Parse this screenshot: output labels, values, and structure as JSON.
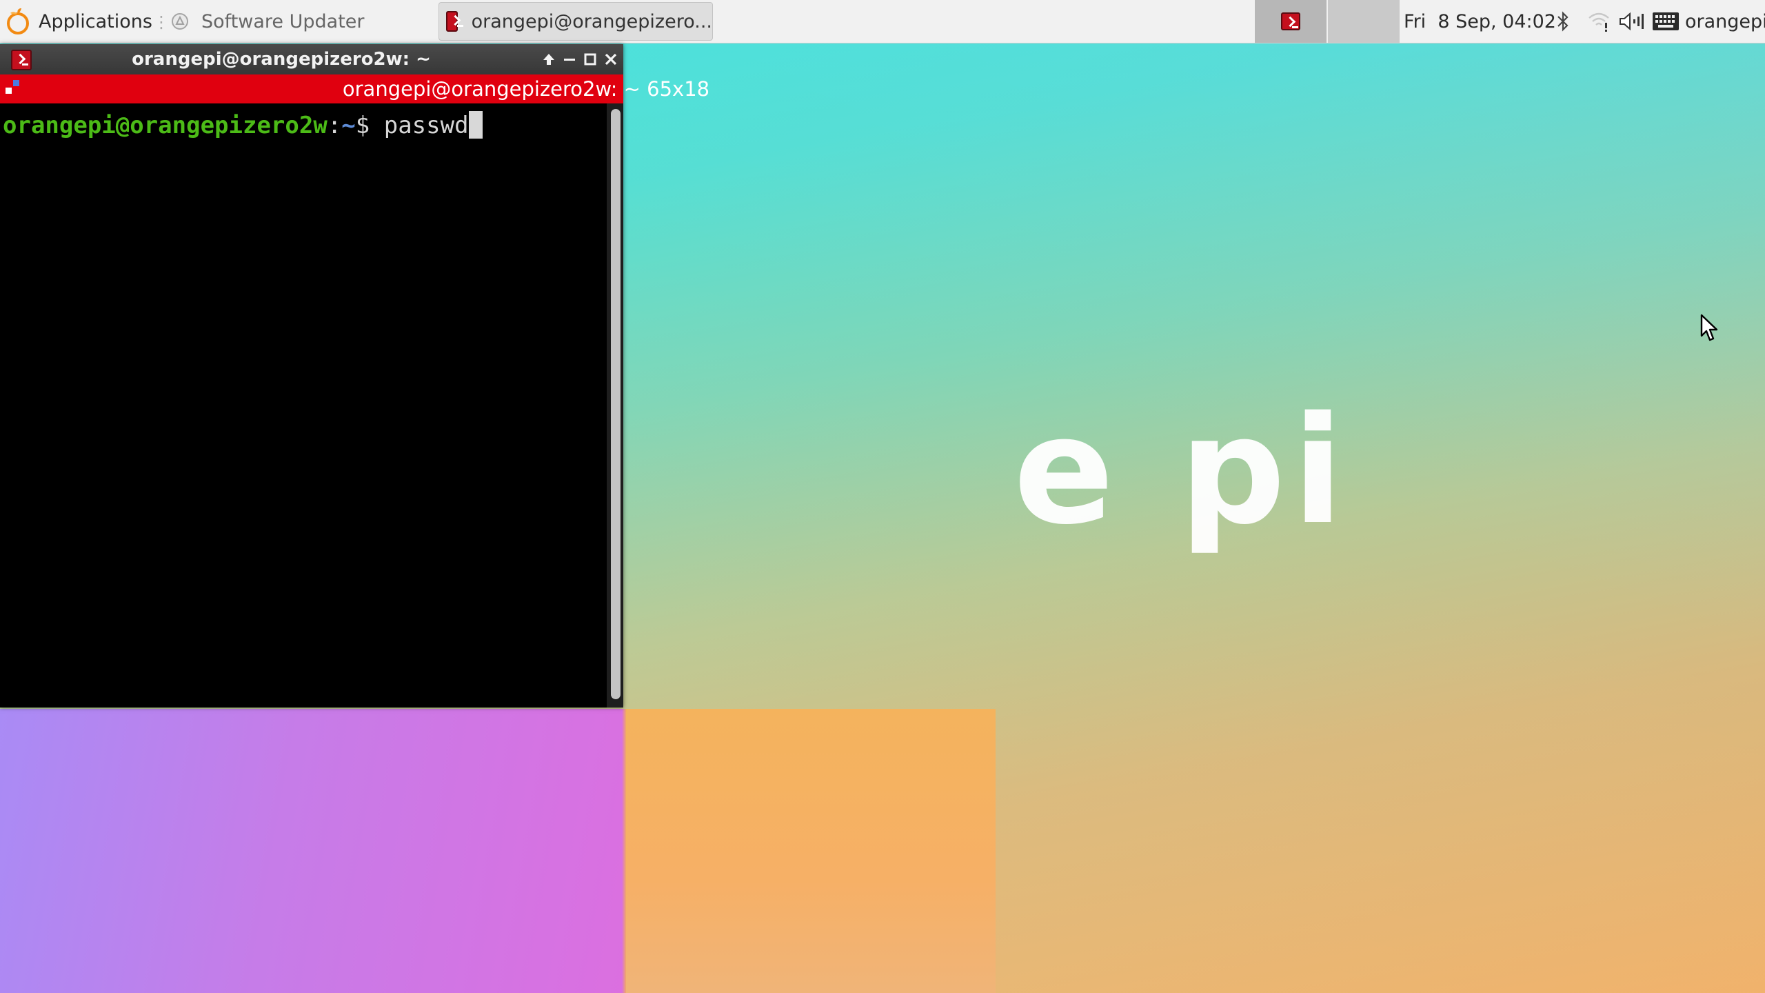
{
  "panel": {
    "applications_label": "Applications",
    "tasks": [
      {
        "label": "Software Updater",
        "icon": "software-updater-icon"
      },
      {
        "label": "orangepi@orangepizero...",
        "icon": "terminal-icon"
      }
    ],
    "clock": "Fri  8 Sep, 04:02",
    "user": "orangepi",
    "tray_icons": [
      "bluetooth-icon",
      "wifi-icon",
      "volume-icon",
      "keyboard-icon"
    ]
  },
  "window": {
    "title": "orangepi@orangepizero2w: ~",
    "header": "orangepi@orangepizero2w: ~ 65x18",
    "controls": [
      "shade",
      "minimize",
      "maximize",
      "close"
    ]
  },
  "terminal": {
    "prompt_user": "orangepi@orangepizero2w",
    "prompt_colon": ":",
    "prompt_path": "~",
    "prompt_symbol": "$ ",
    "command": "passwd"
  },
  "wallpaper": {
    "logo_text": "e pi"
  },
  "colors": {
    "terminal_header": "#e0000f",
    "prompt_user": "#4cbb17",
    "prompt_path": "#5d8bd6"
  }
}
